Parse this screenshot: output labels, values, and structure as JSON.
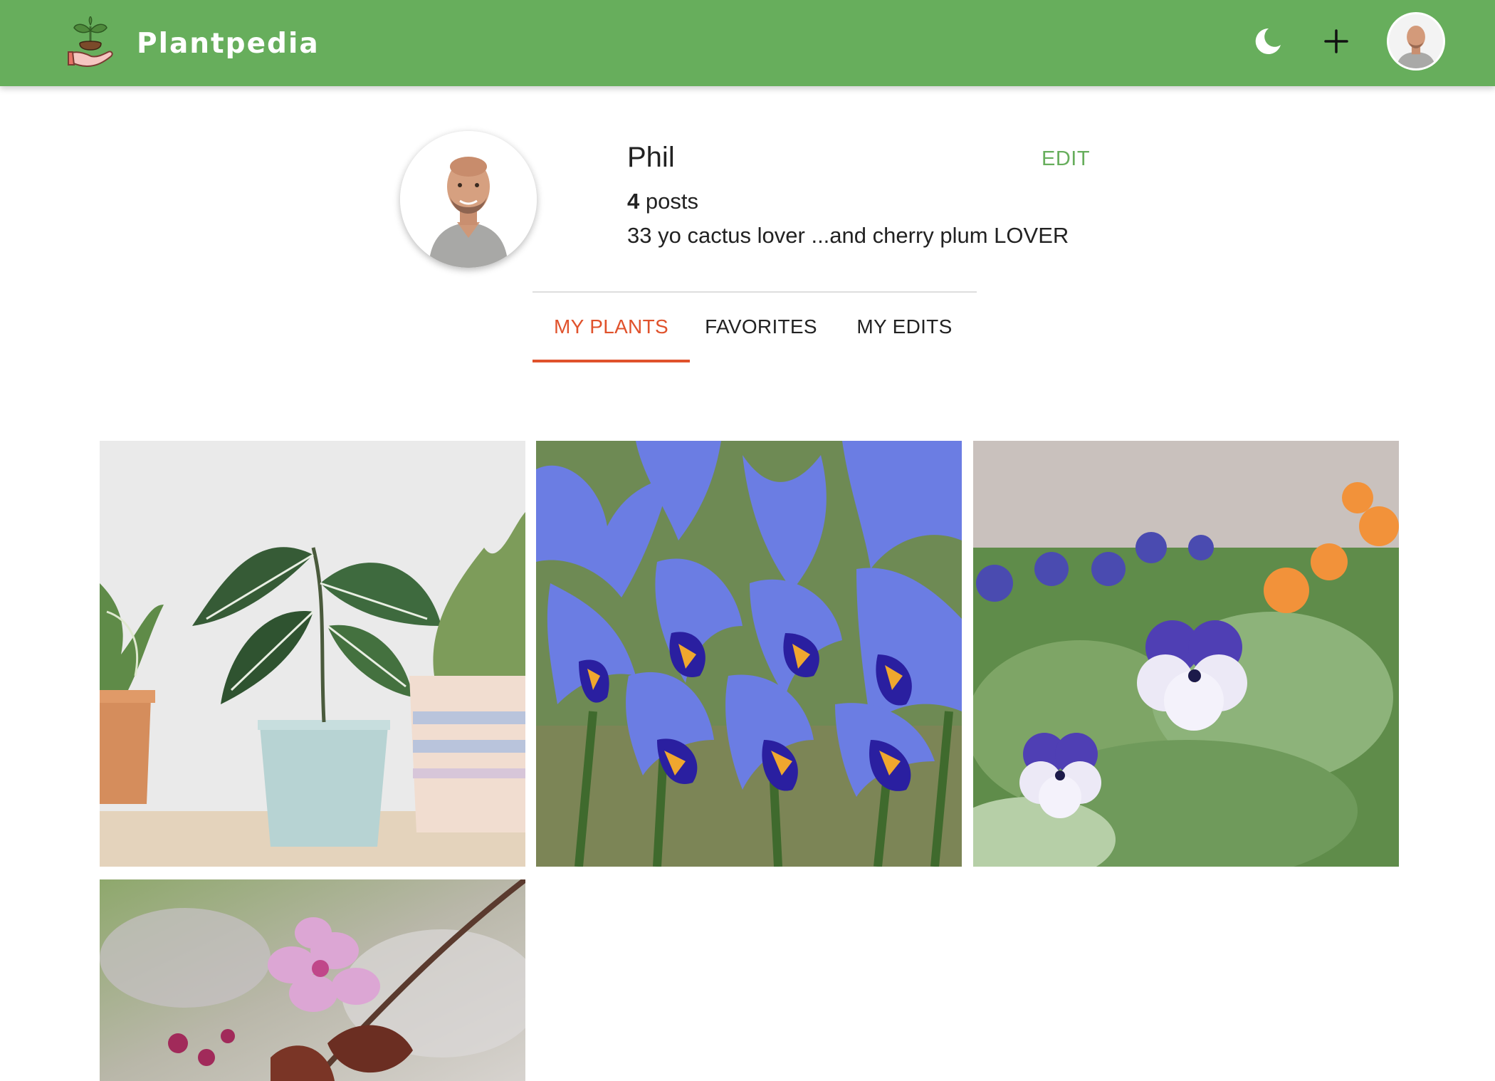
{
  "header": {
    "brand": "Plantpedia",
    "logo_icon": "hand-sprout-icon",
    "actions": {
      "theme_icon": "moon-icon",
      "add_icon": "plus-icon",
      "avatar_label": "user-avatar"
    }
  },
  "profile": {
    "name": "Phil",
    "edit_label": "EDIT",
    "post_count": "4",
    "post_label": " posts",
    "bio": "33 yo cactus lover ...and cherry plum LOVER"
  },
  "tabs": [
    {
      "label": "MY PLANTS",
      "active": true
    },
    {
      "label": "FAVORITES",
      "active": false
    },
    {
      "label": "MY EDITS",
      "active": false
    }
  ],
  "posts": [
    {
      "subject": "potted-houseplants"
    },
    {
      "subject": "blue-iris-flowers"
    },
    {
      "subject": "violet-pansies"
    },
    {
      "subject": "cherry-plum-blossom"
    }
  ],
  "colors": {
    "header_bg": "#67ae5c",
    "accent": "#67ae5c",
    "active_tab": "#e0522c",
    "text": "#222222"
  }
}
